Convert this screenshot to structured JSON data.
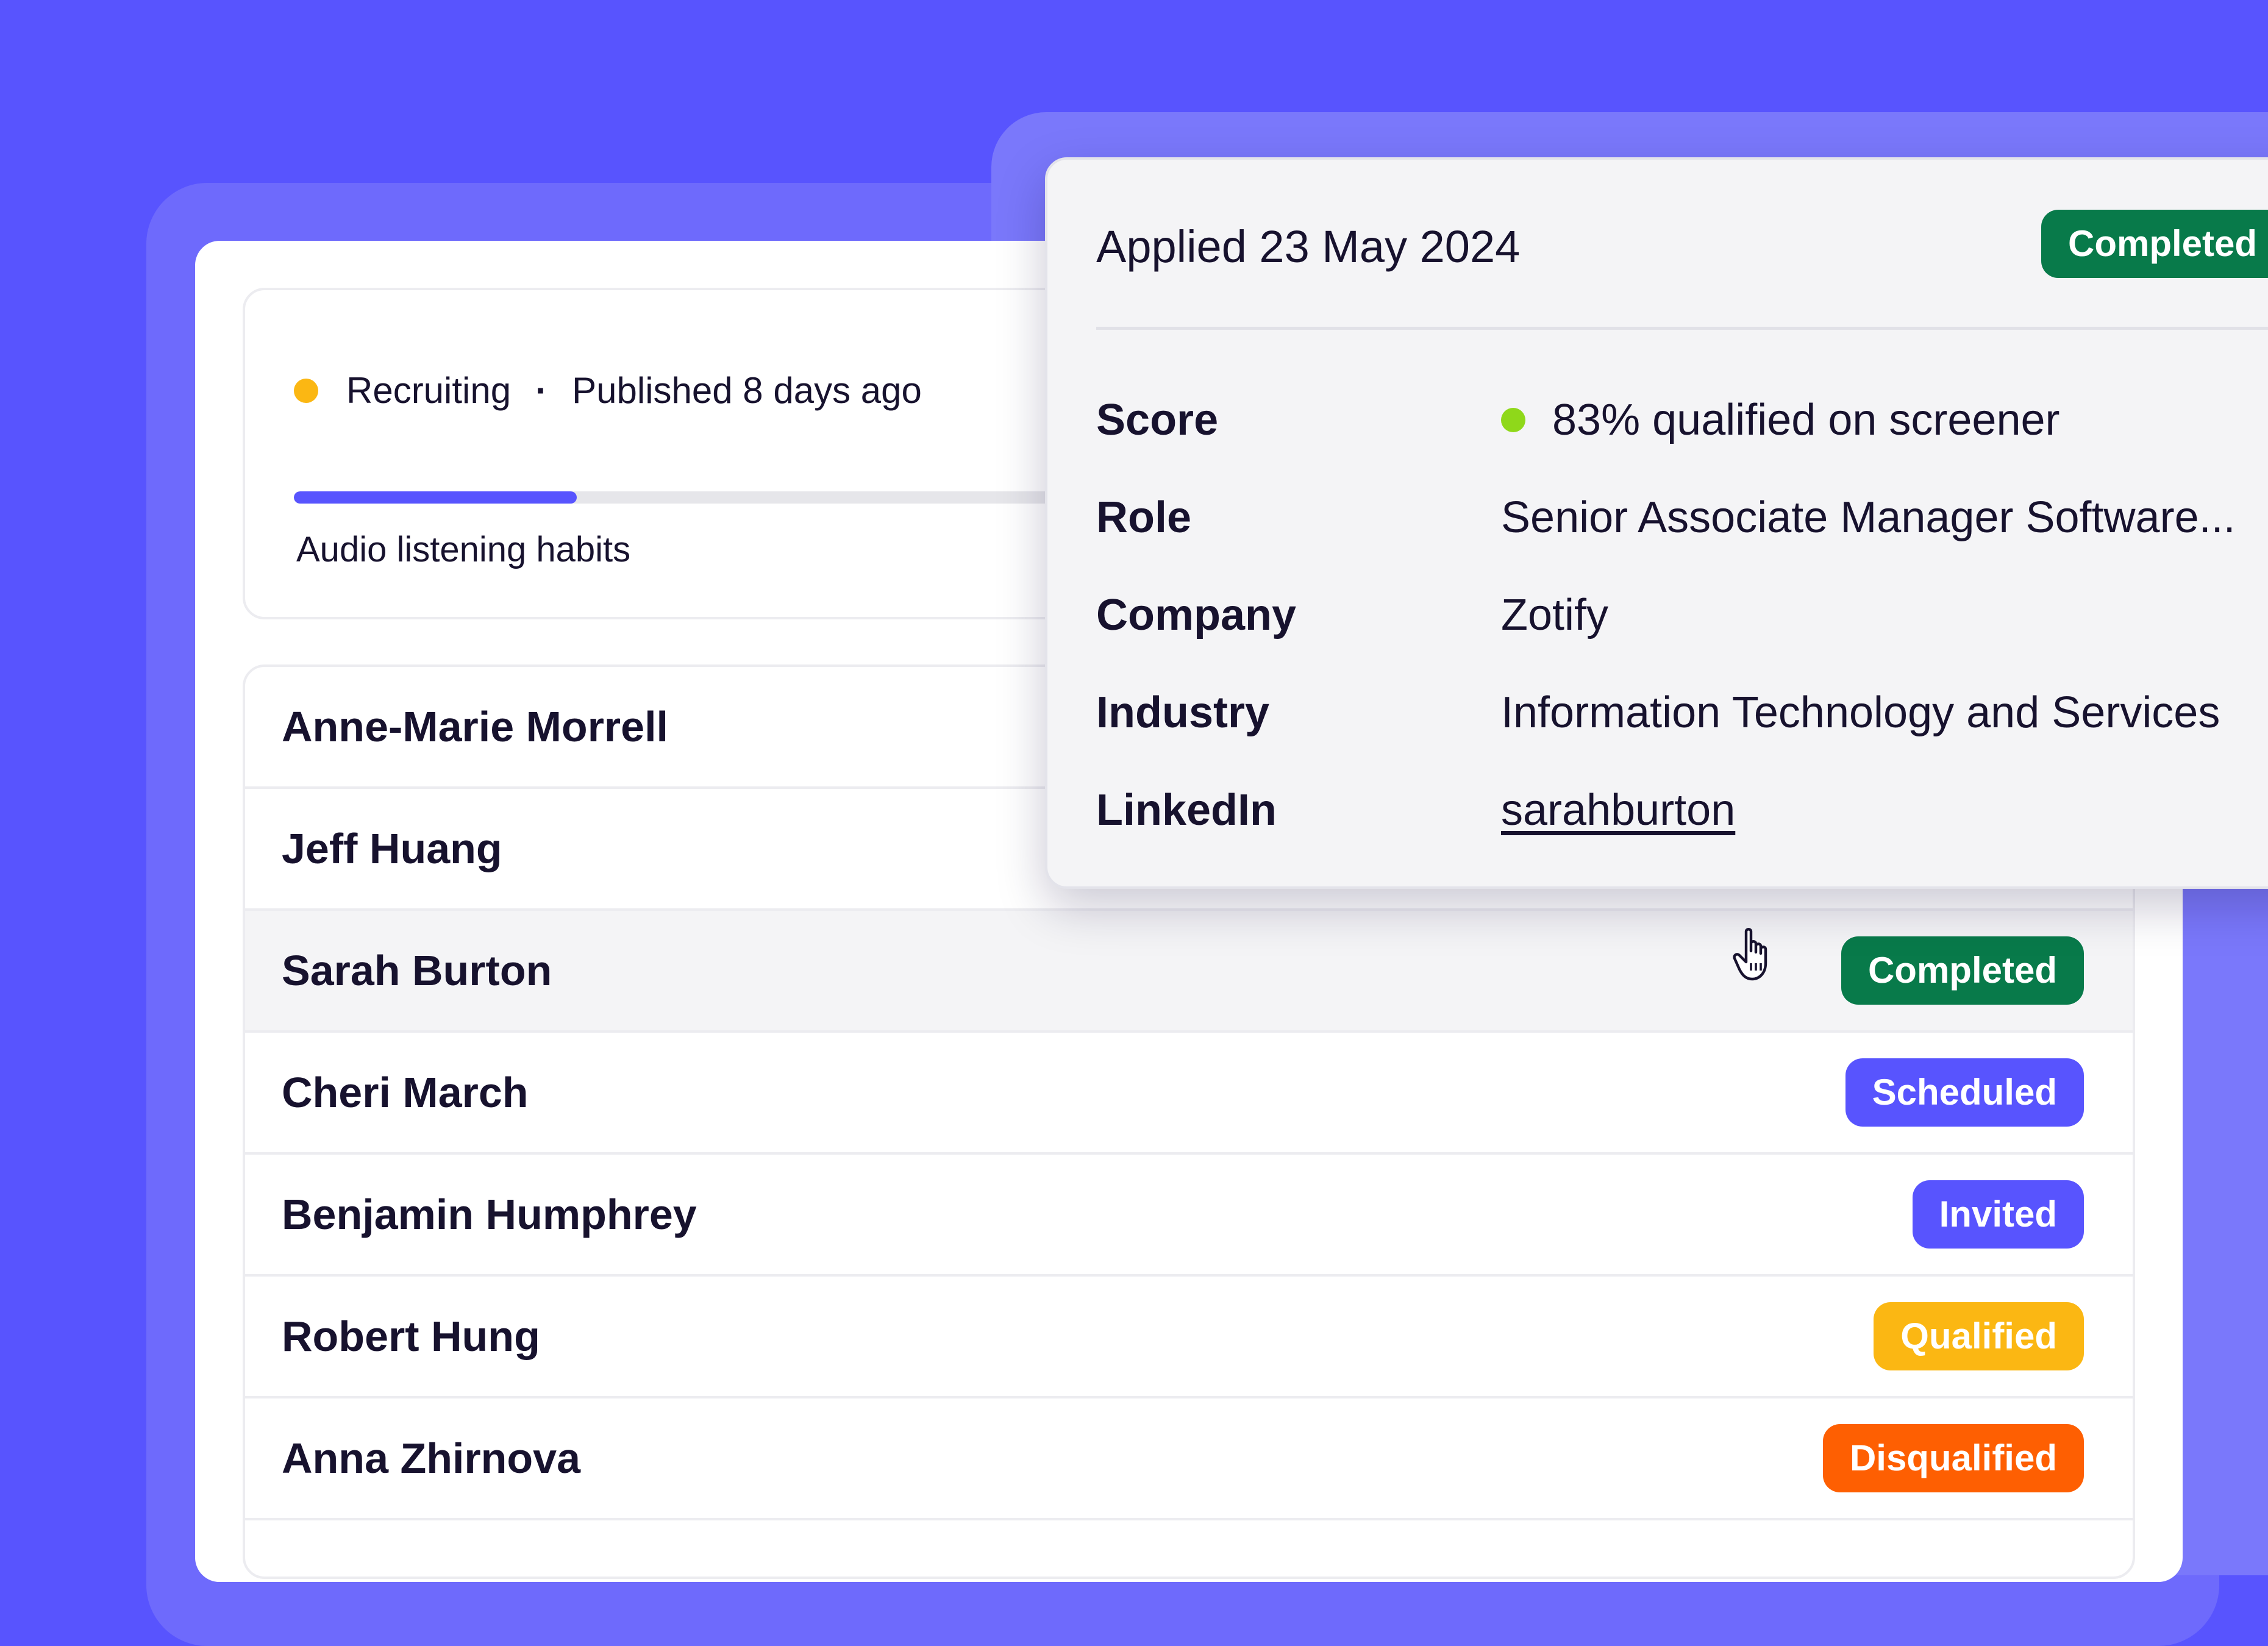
{
  "study": {
    "status": "Recruiting",
    "separator": "·",
    "published": "Published 8 days ago",
    "progress": 0.16,
    "title": "Audio listening habits",
    "status_color": "#fbb713"
  },
  "participants": [
    {
      "name": "Anne-Marie Morrell",
      "status": "",
      "color": ""
    },
    {
      "name": "Jeff Huang",
      "status": "",
      "color": ""
    },
    {
      "name": "Sarah Burton",
      "status": "Completed",
      "color": "#087a4a"
    },
    {
      "name": "Cheri March",
      "status": "Scheduled",
      "color": "#5854fe"
    },
    {
      "name": "Benjamin Humphrey",
      "status": "Invited",
      "color": "#5854fe"
    },
    {
      "name": "Robert Hung",
      "status": "Qualified",
      "color": "#fbb713"
    },
    {
      "name": "Anna Zhirnova",
      "status": "Disqualified",
      "color": "#fe5f02"
    }
  ],
  "popover": {
    "applied": "Applied 23 May 2024",
    "status": "Completed",
    "status_color": "#087a4a",
    "details": {
      "score_label": "Score",
      "score_value": "83% qualified on screener",
      "score_color": "#8fd81a",
      "role_label": "Role",
      "role_value": "Senior Associate Manager Software...",
      "company_label": "Company",
      "company_value": "Zotify",
      "industry_label": "Industry",
      "industry_value": "Information Technology and Services",
      "linkedin_label": "LinkedIn",
      "linkedin_value": "sarahburton"
    }
  },
  "colors": {
    "background": "#5854fe",
    "accent": "#5854fe",
    "completed": "#087a4a",
    "qualified": "#fbb713",
    "disqualified": "#fe5f02"
  },
  "cursor": {
    "icon": "hand-pointer-icon"
  }
}
